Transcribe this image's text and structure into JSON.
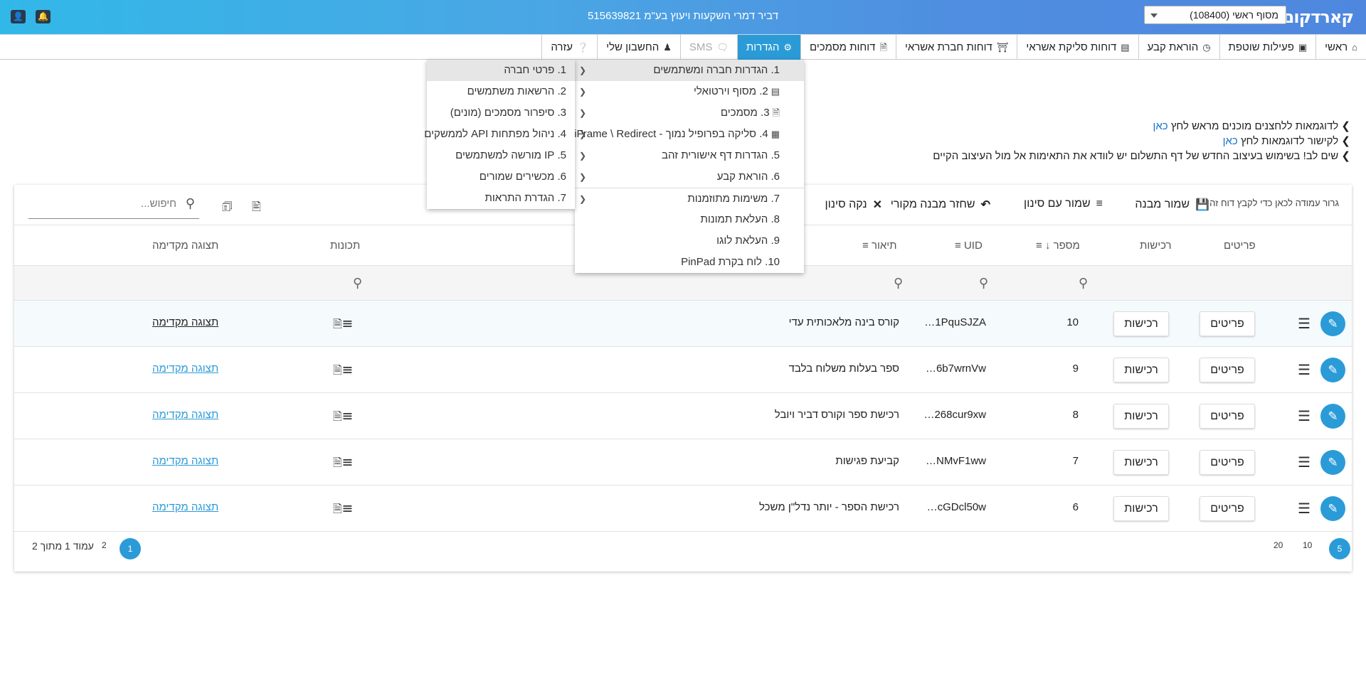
{
  "header": {
    "logo": "קארדקום",
    "terminal": "מסוף ראשי (108400)",
    "company": "דביר דמרי השקעות ויעוץ בע\"מ 515639821"
  },
  "nav": [
    {
      "label": "ראשי",
      "icon": "home-icon"
    },
    {
      "label": "פעילות שוטפת",
      "icon": "briefcase-icon"
    },
    {
      "label": "הוראת קבע",
      "icon": "clock-icon"
    },
    {
      "label": "דוחות סליקת אשראי",
      "icon": "credit-card-icon"
    },
    {
      "label": "דוחות חברת אשראי",
      "icon": "bank-icon"
    },
    {
      "label": "דוחות מסמכים",
      "icon": "document-icon"
    },
    {
      "label": "הגדרות",
      "icon": "cogs-icon",
      "active": true
    },
    {
      "label": "SMS",
      "icon": "comment-icon",
      "disabled": true
    },
    {
      "label": "החשבון שלי",
      "icon": "user-tie-icon"
    },
    {
      "label": "עזרה",
      "icon": "question-icon"
    }
  ],
  "info": {
    "line1": "לדוגמאות ללחצנים מוכנים מראש לחץ",
    "line1_link": "כאן",
    "line2": "לקישור לדוגמאות לחץ",
    "line2_link": "כאן",
    "line3": "שים לב! בשימוש בעיצוב החדש של דף התשלום יש לוודא את התאימות אל מול העיצוב הקיים"
  },
  "toolbar": {
    "hint": "גרור עמודה לכאן כדי לקבץ דוח זה",
    "save_layout": "שמור מבנה",
    "save_filter": "שמור עם סינון",
    "restore": "שחזר מבנה מקורי",
    "clear_filter": "נקה סינון",
    "search_placeholder": "חיפוש..."
  },
  "columns": {
    "items": "פריטים",
    "purchases": "רכישות",
    "number": "מספר",
    "uid": "UID",
    "description": "תיאור",
    "features": "תכונות",
    "preview": "תצוגה מקדימה"
  },
  "rows": [
    {
      "number": "10",
      "uid": "1PquSJZA",
      "description": "קורס בינה מלאכותית עדי",
      "items": "פריטים",
      "purchases": "רכישות",
      "preview": "תצוגה מקדימה"
    },
    {
      "number": "9",
      "uid": "6b7wrnVw",
      "description": "ספר בעלות משלוח בלבד",
      "items": "פריטים",
      "purchases": "רכישות",
      "preview": "תצוגה מקדימה"
    },
    {
      "number": "8",
      "uid": "268cur9xw",
      "description": "רכישת ספר וקורס דביר ויובל",
      "items": "פריטים",
      "purchases": "רכישות",
      "preview": "תצוגה מקדימה"
    },
    {
      "number": "7",
      "uid": "NMvF1ww",
      "description": "קביעת פגישות",
      "items": "פריטים",
      "purchases": "רכישות",
      "preview": "תצוגה מקדימה"
    },
    {
      "number": "6",
      "uid": "cGDcl50w",
      "description": "רכישת הספר - יותר נדל\"ן משכל",
      "items": "פריטים",
      "purchases": "רכישות",
      "preview": "תצוגה מקדימה"
    }
  ],
  "pager": {
    "sizes": [
      "5",
      "10",
      "20"
    ],
    "active_size": "5",
    "pages": [
      "1",
      "2"
    ],
    "current_page": "1",
    "page_info": "עמוד 1 מתוך 2"
  },
  "settings_menu": [
    {
      "label": "1. הגדרות חברה ומשתמשים",
      "sub": true,
      "selected": true
    },
    {
      "label": "2. מסוף וירטואלי",
      "sub": true,
      "icon": "credit-card-icon"
    },
    {
      "label": "3. מסמכים",
      "sub": true,
      "icon": "document-icon"
    },
    {
      "label": "4. סליקה בפרופיל נמוך - iFrame \\ Redirect",
      "sub": true,
      "icon": "id-card-icon"
    },
    {
      "label": "5. הגדרות דף אישורית זהב",
      "sub": true
    },
    {
      "label": "6. הוראת קבע",
      "sub": true
    },
    {
      "label": "7. משימות מתוזמנות",
      "sub": true
    },
    {
      "label": "8. העלאת תמונות",
      "sub": false
    },
    {
      "label": "9. העלאת לוגו",
      "sub": false
    },
    {
      "label": "10. לוח בקרת PinPad",
      "sub": false
    }
  ],
  "company_submenu": [
    {
      "label": "1. פרטי חברה",
      "selected": true
    },
    {
      "label": "2. הרשאות משתמשים"
    },
    {
      "label": "3. סיפרור מסמכים (מונים)"
    },
    {
      "label": "4. ניהול מפתחות API לממשקים"
    },
    {
      "label": "5. IP מורשה למשתמשים"
    },
    {
      "label": "6. מכשירים שמורים"
    },
    {
      "label": "7. הגדרת התראות"
    }
  ]
}
